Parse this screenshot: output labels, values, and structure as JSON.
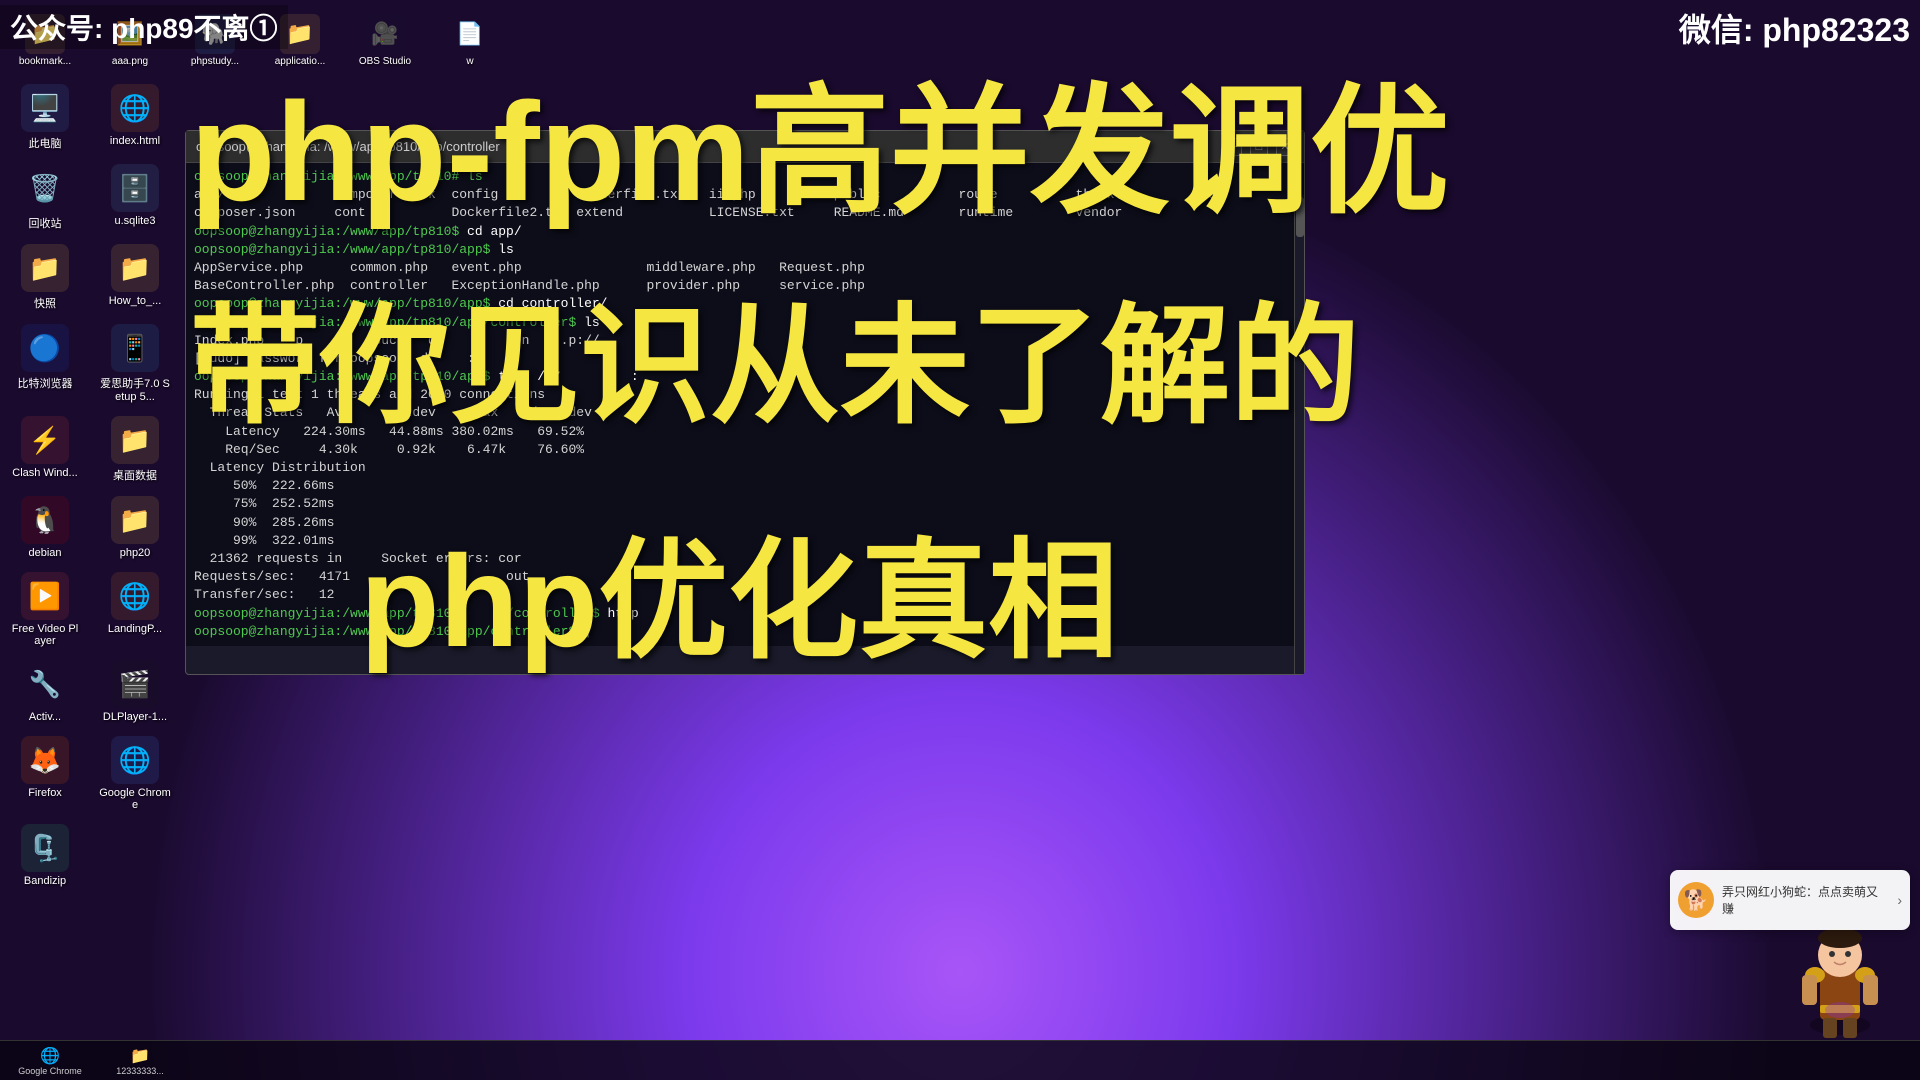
{
  "watermark": {
    "top_left": "公众号: php89不离①",
    "top_right": "微信: php82323"
  },
  "overlay_texts": {
    "line1": "php-fpm高并发调优",
    "line2": "带你见识从未了解的",
    "line3": "php优化真相"
  },
  "terminal": {
    "title": "oopsoop@zhangyijia: /www/app/tp810/app/controller",
    "lines": [
      "oopsoop@zhangyijia:/www/app/tp810# ls",
      "app/              composer.lock  config          Dockerfile.txt   ii.php          public          route          think          view",
      "composer.json     cont           Dockerfile2.txt extend           LICENSE.txt     README.md       runtime        vendor",
      "oopsoop@zhangyijia:/www/app/tp810$ cd app/",
      "oopsoop@zhangyijia:/www/app/tp810/app$ ls",
      "AppService.php      common.php   event.php                middleware.php   Request.php",
      "BaseController.php  controller   ExceptionHandle.php      provider.php     service.php",
      "oopsoop@zhangyijia:/www/app/tp810/app$ cd controller/",
      "oopsoop@zhangyijia:/www/app/tp810/app/controller$ ls",
      "Index.php    p    s    suc    de    a    en    .p://",
      "[sudo] password for oopsoop: d     :      ",
      "oopsoop@zhangyijia:/www/app/tp810/app$ t    /17         :",
      "Running 1 test 1 threads and 2000 connections",
      "  Thread Stats   Avg      Stdev     Max   +/- Stdev",
      "    Latency   224.30ms   44.88ms 380.02ms   69.52%",
      "    Req/Sec     4.30k     0.92k    6.47k    76.60%",
      "  Latency Distribution",
      "     50%  222.66ms",
      "     75%  252.52ms",
      "     90%  285.26ms",
      "     99%  322.01ms",
      "  21362 requests in     Socket errors: cor",
      "Requests/sec:   4171                    out",
      "Transfer/sec:   12",
      "oopsoop@zhangyijia:/www/app/tp810/      /controller$ htop",
      "oopsoop@zhangyijia:/www/app/tp810/app/controller$ |"
    ]
  },
  "desktop_icons": [
    {
      "id": "computer",
      "label": "此电脑",
      "icon": "🖥️",
      "color": "#4a90e2"
    },
    {
      "id": "index-html",
      "label": "index.html",
      "icon": "🌐",
      "color": "#e8842c"
    },
    {
      "id": "recycle",
      "label": "回收站",
      "icon": "🗑️",
      "color": "#888"
    },
    {
      "id": "sqlite3",
      "label": "u.sqlite3",
      "icon": "🗄️",
      "color": "#5b9bd5"
    },
    {
      "id": "kuai",
      "label": "快照",
      "icon": "📁",
      "color": "#f0c040"
    },
    {
      "id": "how-to",
      "label": "How_to_...",
      "icon": "📁",
      "color": "#f0c040"
    },
    {
      "id": "brows",
      "label": "比特浏览器",
      "icon": "🔵",
      "color": "#1a56db"
    },
    {
      "id": "aisi",
      "label": "爱思助手7.0 Setup 5...",
      "icon": "📱",
      "color": "#3498db"
    },
    {
      "id": "clash-wind",
      "label": "Clash Wind...",
      "icon": "⚡",
      "color": "#e74c3c"
    },
    {
      "id": "desktop-data",
      "label": "桌面数据",
      "icon": "📁",
      "color": "#f0c040"
    },
    {
      "id": "debian",
      "label": "debian",
      "icon": "🐧",
      "color": "#d40000"
    },
    {
      "id": "php20",
      "label": "php20",
      "icon": "📁",
      "color": "#f0c040"
    },
    {
      "id": "free-video",
      "label": "Free Video Player",
      "icon": "▶️",
      "color": "#e74c3c"
    },
    {
      "id": "landing-p",
      "label": "LandingP...",
      "icon": "🌐",
      "color": "#e8842c"
    },
    {
      "id": "activ",
      "label": "Activ...",
      "icon": "🔧",
      "color": "#888"
    },
    {
      "id": "dlplayer",
      "label": "DLPlayer-1...",
      "icon": "🎬",
      "color": "#1a1a1a"
    },
    {
      "id": "firefox",
      "label": "Firefox",
      "icon": "🦊",
      "color": "#ff6600"
    },
    {
      "id": "google-chrome",
      "label": "Google Chrome",
      "icon": "🌐",
      "color": "#4285f4"
    },
    {
      "id": "bandizip",
      "label": "Bandizip",
      "icon": "🗜️",
      "color": "#2ecc71"
    }
  ],
  "top_icons": [
    {
      "id": "bookmark",
      "label": "bookmark...",
      "icon": "📁",
      "color": "#f0c040"
    },
    {
      "id": "aaa-png",
      "label": "aaa.png",
      "icon": "🖼️",
      "color": "#888"
    },
    {
      "id": "phpstudy",
      "label": "phpstudy...",
      "icon": "🐘",
      "color": "#4a9eda"
    },
    {
      "id": "applications",
      "label": "applicatio...",
      "icon": "📁",
      "color": "#f0c040"
    },
    {
      "id": "obs-studio",
      "label": "OBS Studio",
      "icon": "🎥",
      "color": "#1a1a2e"
    },
    {
      "id": "w",
      "label": "w",
      "icon": "📄",
      "color": "#fff"
    }
  ],
  "taskbar_items": [
    {
      "id": "google-chrome-task",
      "label": "Google Chrome",
      "icon": "🌐"
    },
    {
      "id": "file-1233",
      "label": "12333333...",
      "icon": "📁"
    }
  ],
  "notification": {
    "avatar": "🐕",
    "text": "弄只网红小狗蛇：点点卖萌又赚",
    "arrow": "›"
  }
}
